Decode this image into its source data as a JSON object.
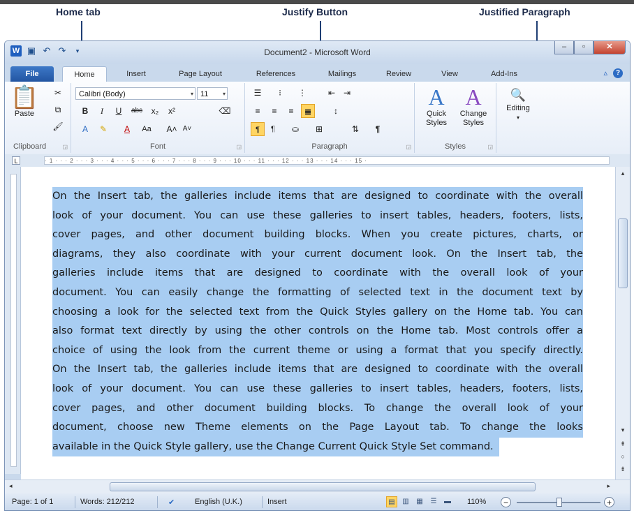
{
  "annotations": {
    "home_tab": "Home tab",
    "justify_button": "Justify Button",
    "justified_paragraph": "Justified Paragraph"
  },
  "window": {
    "title": "Document2 - Microsoft Word"
  },
  "tabs": [
    "File",
    "Home",
    "Insert",
    "Page Layout",
    "References",
    "Mailings",
    "Review",
    "View",
    "Add-Ins"
  ],
  "ribbon": {
    "clipboard": {
      "paste": "Paste",
      "label": "Clipboard"
    },
    "font": {
      "name": "Calibri (Body)",
      "size": "11",
      "label": "Font"
    },
    "paragraph": {
      "label": "Paragraph"
    },
    "styles": {
      "quick": "Quick\nStyles",
      "change": "Change\nStyles",
      "label": "Styles"
    },
    "editing": {
      "label": "Editing"
    }
  },
  "ruler": "· 1 · · · 2 · · · 3 · · · 4 · · · 5 · · · 6 · · · 7 · · · 8 · · · 9 · · · 10 · · · 11 · · · 12 · · · 13 · · · 14 · · · 15 ·",
  "document": {
    "lines": [
      "On the Insert tab, the galleries include items that are designed to coordinate with the overall",
      "look of your document. You can use these galleries to insert tables, headers, footers, lists,",
      "cover pages, and other document building blocks. When you create pictures, charts, or",
      "diagrams, they also coordinate with your current document look. On the Insert tab, the",
      "galleries include items that are designed to coordinate with the overall look of your",
      "document. You can easily change the formatting of selected text in the document text by",
      "choosing a look for the selected text from the Quick Styles gallery on the Home tab. You can",
      "also format text directly by using the other controls on the Home tab. Most controls offer a",
      "choice of using the look from the current theme or using a format that you specify directly.",
      "On the Insert tab, the galleries include items that are designed to coordinate with the overall",
      "look of your document. You can use these galleries to insert tables, headers, footers, lists,",
      "cover pages, and other document building blocks. To change the overall look of your",
      "document, choose new Theme elements on the Page Layout tab. To change the looks",
      "available in the Quick Style gallery, use the Change Current Quick Style Set command."
    ]
  },
  "status": {
    "page": "Page: 1 of 1",
    "words": "Words: 212/212",
    "language": "English (U.K.)",
    "mode": "Insert",
    "zoom": "110%"
  },
  "colors": {
    "selection": "#a8cdf2",
    "accent": "#2b579a"
  }
}
